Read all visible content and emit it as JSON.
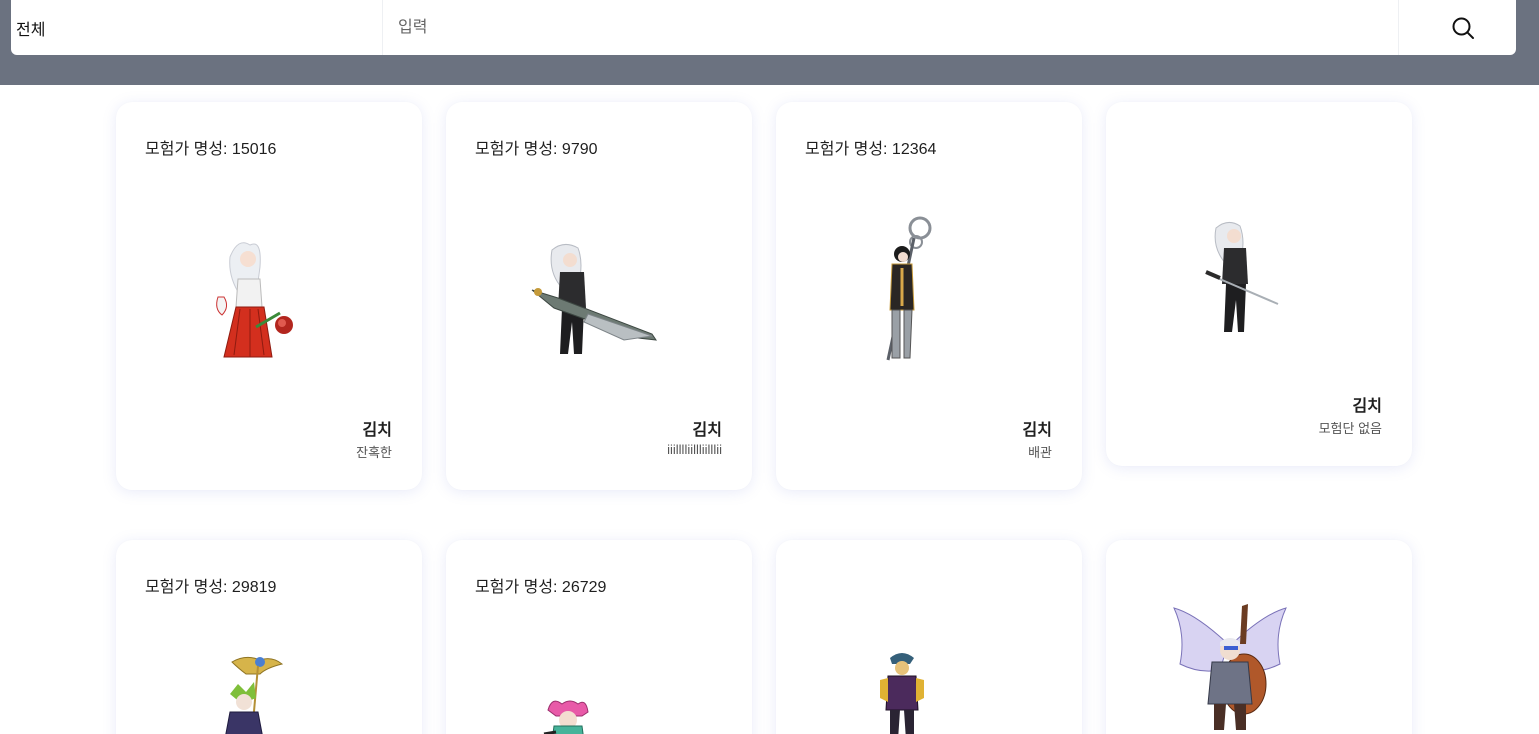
{
  "search": {
    "scope_label": "전체",
    "placeholder": "입력",
    "value": ""
  },
  "cards": [
    {
      "fame": "모험가 명성: 15016",
      "name": "김치",
      "guild": "잔혹한"
    },
    {
      "fame": "모험가 명성: 9790",
      "name": "김치",
      "guild": "iiilllliillliilllii"
    },
    {
      "fame": "모험가 명성: 12364",
      "name": "김치",
      "guild": "배관"
    },
    {
      "fame": "",
      "name": "김치",
      "guild": "모험단 없음"
    },
    {
      "fame": "모험가 명성: 29819",
      "name": "",
      "guild": ""
    },
    {
      "fame": "모험가 명성: 26729",
      "name": "",
      "guild": ""
    },
    {
      "fame": "",
      "name": "",
      "guild": ""
    },
    {
      "fame": "",
      "name": "",
      "guild": ""
    }
  ],
  "colors": {
    "topbar": "#6b7280",
    "card_background": "#ffffff"
  },
  "icons": {
    "search": "search-icon"
  }
}
